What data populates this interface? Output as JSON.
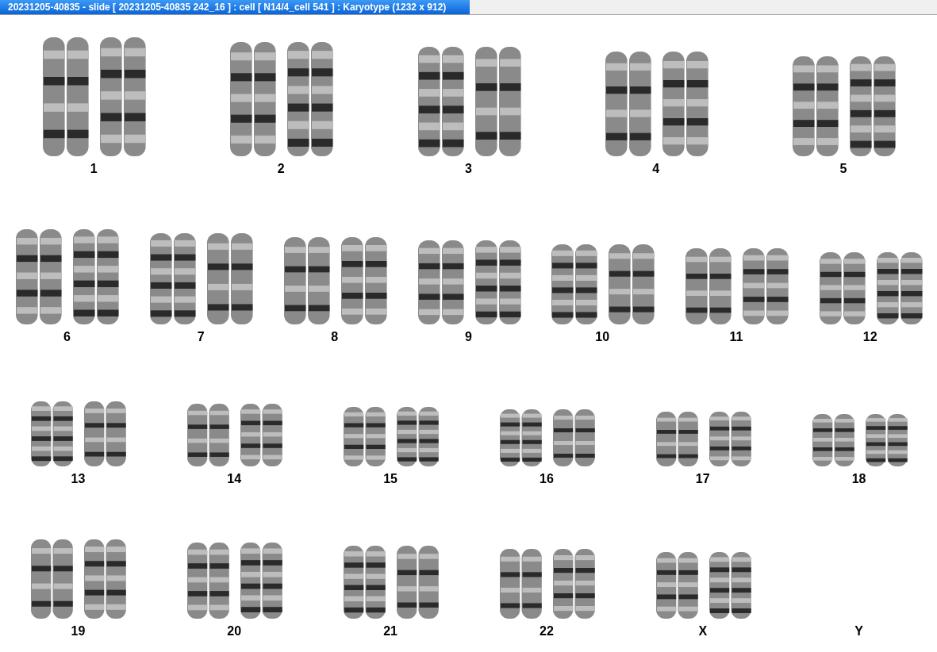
{
  "window": {
    "title": "20231205-40835 - slide [ 20231205-40835 242_16 ] : cell [ N14/4_cell 541 ] : Karyotype  (1232 x 912)"
  },
  "karyotype_rows": [
    {
      "chromosomes": [
        {
          "label": "1",
          "present": true
        },
        {
          "label": "2",
          "present": true
        },
        {
          "label": "3",
          "present": true
        },
        {
          "label": "4",
          "present": true
        },
        {
          "label": "5",
          "present": true
        }
      ]
    },
    {
      "chromosomes": [
        {
          "label": "6",
          "present": true
        },
        {
          "label": "7",
          "present": true
        },
        {
          "label": "8",
          "present": true
        },
        {
          "label": "9",
          "present": true
        },
        {
          "label": "10",
          "present": true
        },
        {
          "label": "11",
          "present": true
        },
        {
          "label": "12",
          "present": true
        }
      ]
    },
    {
      "chromosomes": [
        {
          "label": "13",
          "present": true
        },
        {
          "label": "14",
          "present": true
        },
        {
          "label": "15",
          "present": true
        },
        {
          "label": "16",
          "present": true
        },
        {
          "label": "17",
          "present": true
        },
        {
          "label": "18",
          "present": true
        }
      ]
    },
    {
      "chromosomes": [
        {
          "label": "19",
          "present": true
        },
        {
          "label": "20",
          "present": true
        },
        {
          "label": "21",
          "present": true
        },
        {
          "label": "22",
          "present": true
        },
        {
          "label": "X",
          "present": true
        },
        {
          "label": "Y",
          "present": false
        }
      ]
    }
  ]
}
